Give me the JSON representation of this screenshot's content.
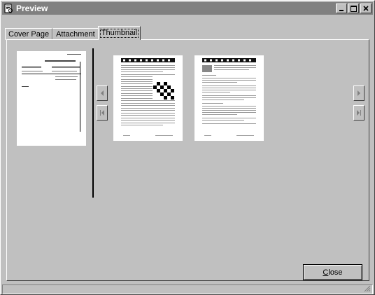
{
  "window": {
    "title": "Preview"
  },
  "tabs": [
    {
      "label": "Cover Page",
      "active": false
    },
    {
      "label": "Attachment",
      "active": false
    },
    {
      "label": "Thumbnail",
      "active": true
    }
  ],
  "buttons": {
    "close_label": "Close",
    "close_mnemonic": "C"
  },
  "thumbnails": [
    {
      "kind": "cover-page"
    },
    {
      "kind": "attachment-page-1"
    },
    {
      "kind": "attachment-page-2"
    }
  ],
  "icons": {
    "app": "preview-doc-icon",
    "minimize": "minimize-icon",
    "maximize": "maximize-icon",
    "close": "close-icon",
    "prev": "prev-page-icon",
    "first": "first-page-icon",
    "next": "next-page-icon",
    "last": "last-page-icon"
  },
  "colors": {
    "face": "#c0c0c0",
    "titlebar": "#808080",
    "page": "#ffffff"
  }
}
